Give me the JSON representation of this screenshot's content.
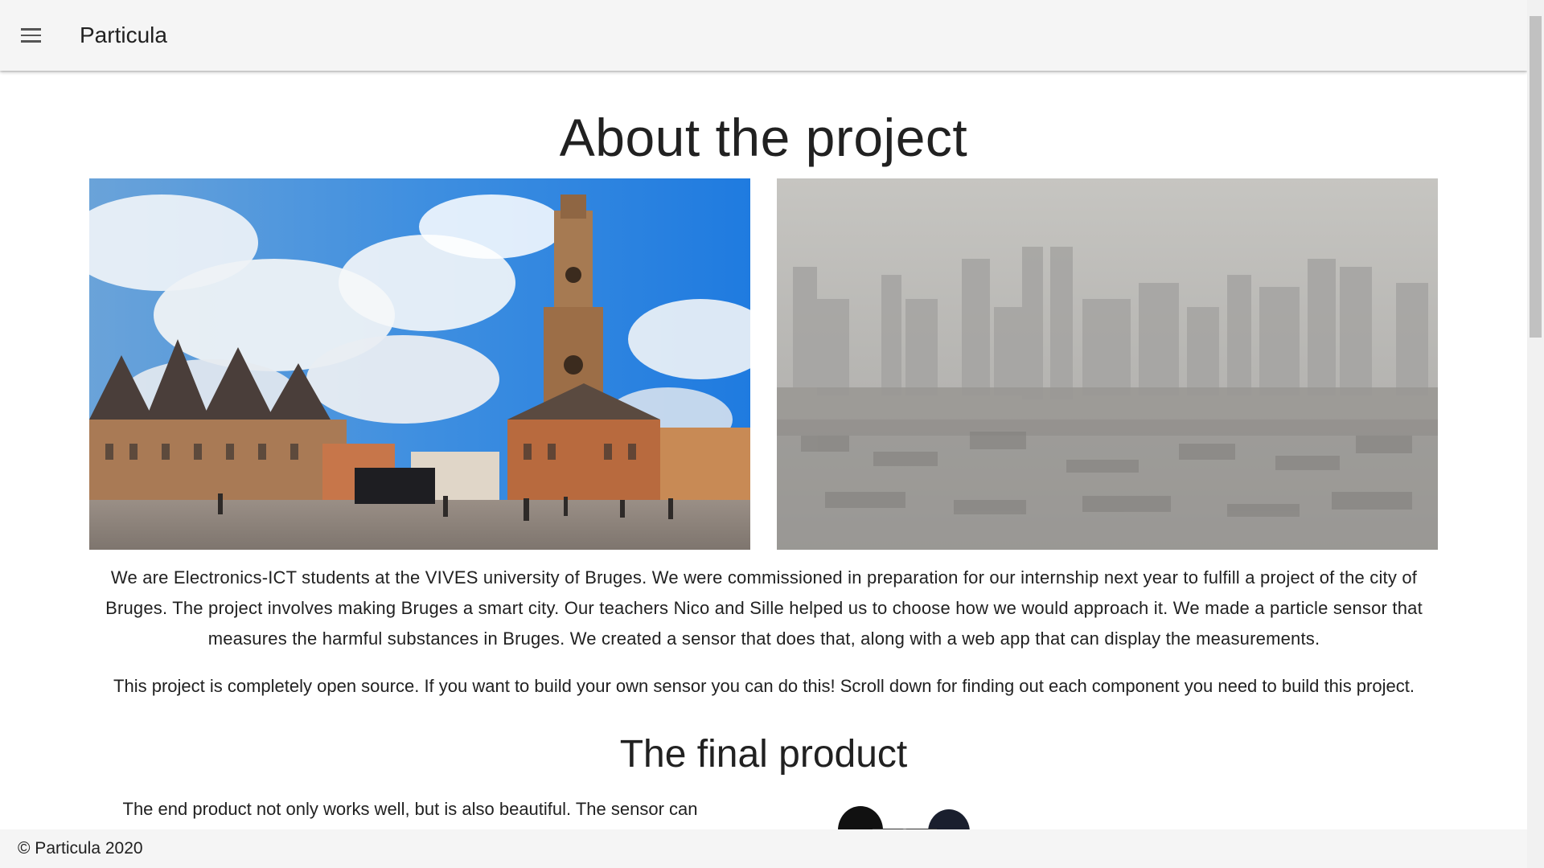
{
  "app": {
    "title": "Particula"
  },
  "icons": {
    "menu": "menu-icon"
  },
  "main": {
    "heading": "About the project",
    "intro": "We are Electronics-ICT students at the VIVES university of Bruges. We were commissioned in preparation for our internship next year to fulfill a project of the city of Bruges. The project involves making Bruges a smart city. Our teachers Nico and Sille helped us to choose how we would approach it. We made a particle sensor that measures the harmful substances in Bruges. We created a sensor that does that, along with a web app that can display the measurements.",
    "open_source": "This project is completely open source. If you want to build your own sensor you can do this! Scroll down for finding out each component you need to build this project.",
    "final_heading": "The final product",
    "final_text": "The end product not only works well, but is also beautiful. The sensor can"
  },
  "footer": {
    "copyright": "© Particula 2020"
  },
  "colors": {
    "appbar": "#f5f5f5",
    "footer": "#f5f5f5",
    "text": "#212121"
  }
}
